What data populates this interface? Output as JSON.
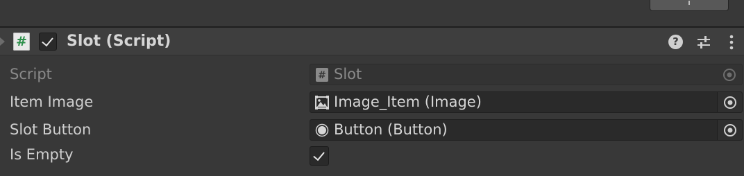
{
  "component": {
    "title": "Slot (Script)",
    "enabled": true,
    "script_icon_glyph": "#",
    "help_icon_glyph": "?"
  },
  "properties": [
    {
      "label": "Script",
      "value": "Slot",
      "icon": "script-icon",
      "disabled": true
    },
    {
      "label": "Item Image",
      "value": "Image_Item (Image)",
      "icon": "image-icon",
      "disabled": false
    },
    {
      "label": "Slot Button",
      "value": "Button (Button)",
      "icon": "button-icon",
      "disabled": false
    },
    {
      "label": "Is Empty",
      "checked": true
    }
  ],
  "colors": {
    "background": "#383838",
    "header": "#3e3e3e",
    "field": "#2a2a2a",
    "script_icon_green": "#2c8f4a"
  }
}
